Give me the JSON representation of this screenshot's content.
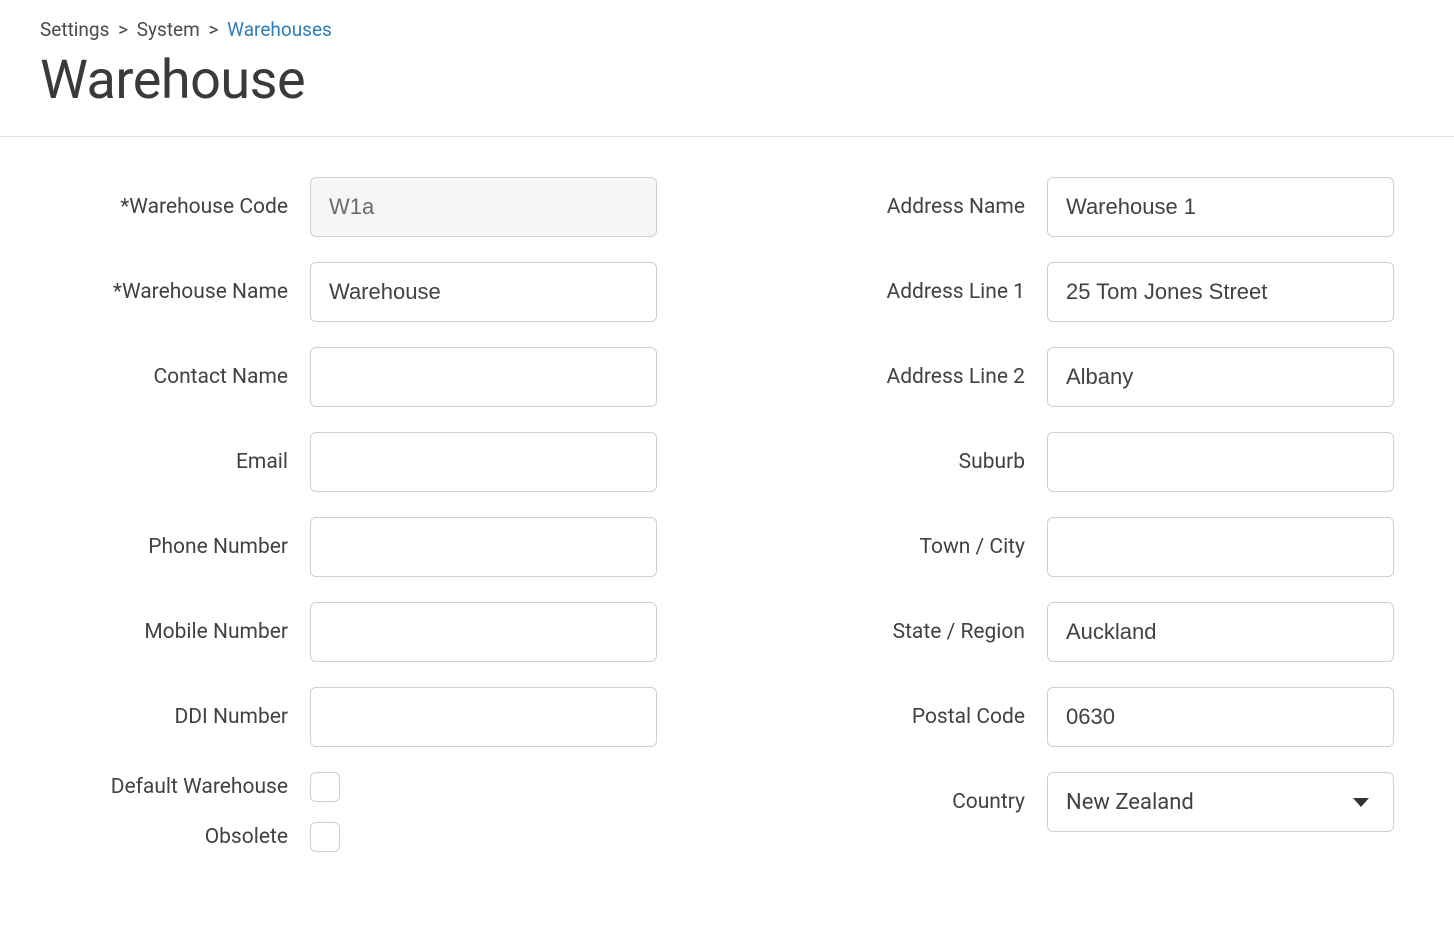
{
  "breadcrumb": {
    "settings": "Settings",
    "system": "System",
    "warehouses": "Warehouses"
  },
  "title": "Warehouse",
  "left": {
    "warehouse_code": {
      "label": "*Warehouse Code",
      "value": "W1a"
    },
    "warehouse_name": {
      "label": "*Warehouse Name",
      "value": "Warehouse"
    },
    "contact_name": {
      "label": "Contact Name",
      "value": ""
    },
    "email": {
      "label": "Email",
      "value": ""
    },
    "phone_number": {
      "label": "Phone Number",
      "value": ""
    },
    "mobile_number": {
      "label": "Mobile Number",
      "value": ""
    },
    "ddi_number": {
      "label": "DDI Number",
      "value": ""
    },
    "default_warehouse": {
      "label": "Default Warehouse",
      "checked": false
    },
    "obsolete": {
      "label": "Obsolete",
      "checked": false
    }
  },
  "right": {
    "address_name": {
      "label": "Address Name",
      "value": "Warehouse 1"
    },
    "address_line_1": {
      "label": "Address Line 1",
      "value": "25 Tom Jones Street"
    },
    "address_line_2": {
      "label": "Address Line 2",
      "value": "Albany"
    },
    "suburb": {
      "label": "Suburb",
      "value": ""
    },
    "town_city": {
      "label": "Town / City",
      "value": ""
    },
    "state_region": {
      "label": "State / Region",
      "value": "Auckland"
    },
    "postal_code": {
      "label": "Postal Code",
      "value": "0630"
    },
    "country": {
      "label": "Country",
      "value": "New Zealand"
    }
  }
}
